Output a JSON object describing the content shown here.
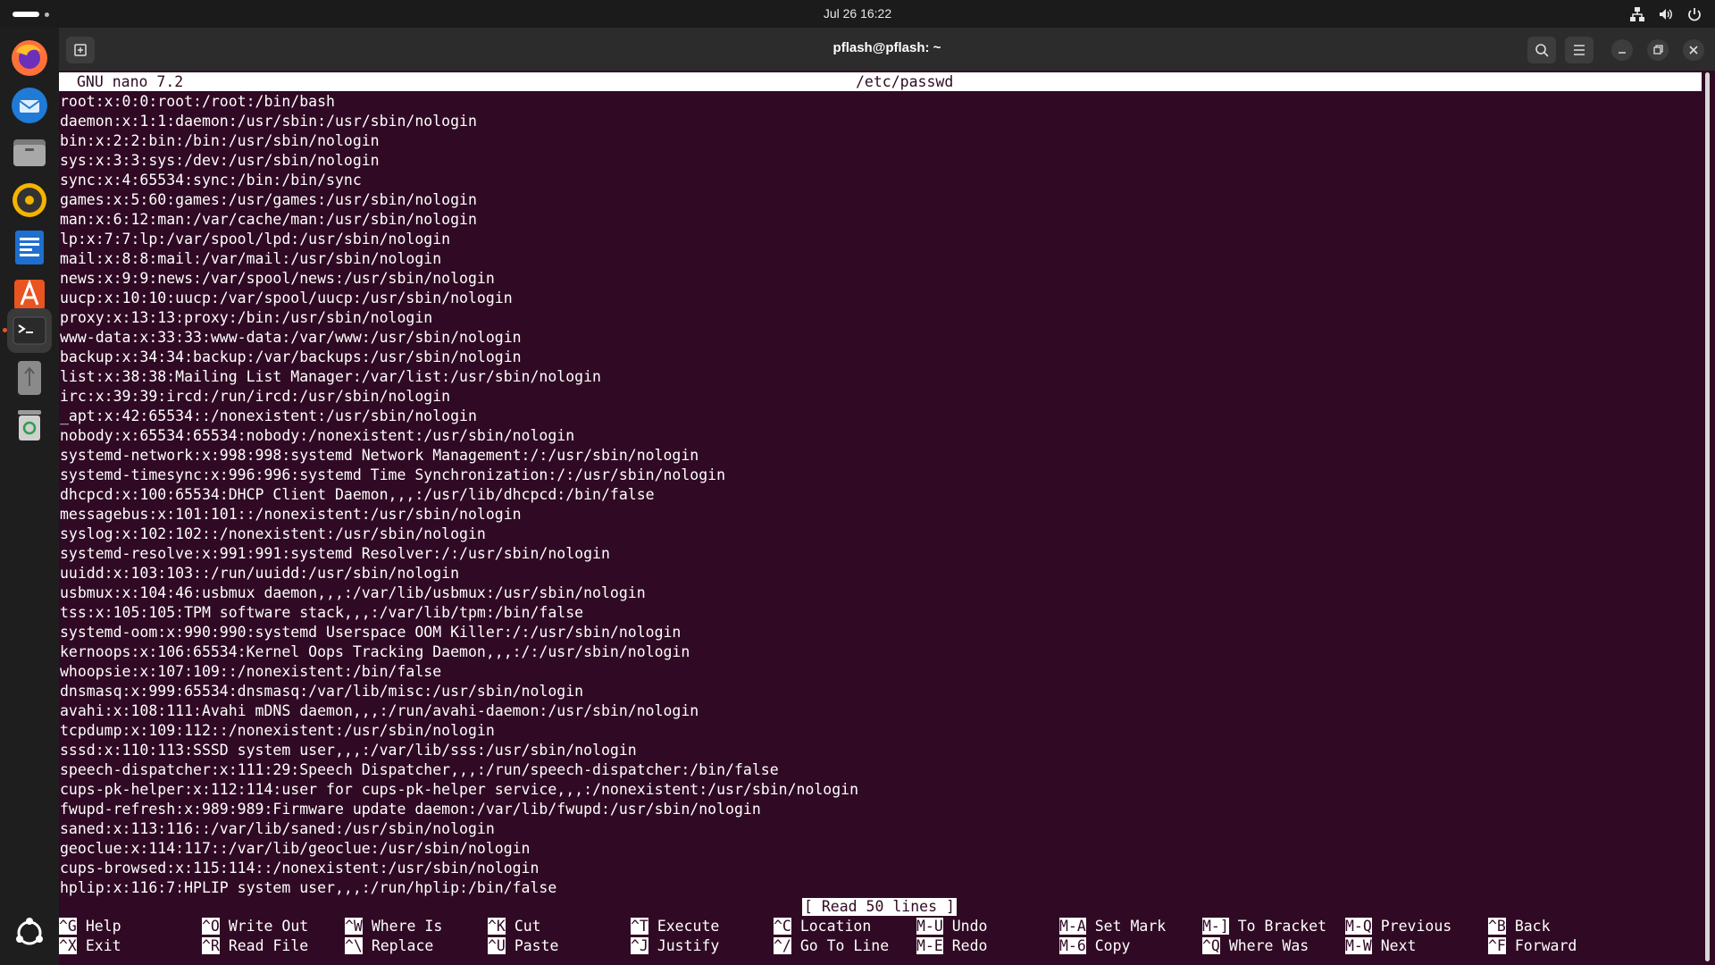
{
  "topbar": {
    "clock": "Jul 26  16:22"
  },
  "window": {
    "title": "pflash@pflash: ~"
  },
  "nano": {
    "version": "GNU nano 7.2",
    "filename": "/etc/passwd",
    "lines": [
      "root:x:0:0:root:/root:/bin/bash",
      "daemon:x:1:1:daemon:/usr/sbin:/usr/sbin/nologin",
      "bin:x:2:2:bin:/bin:/usr/sbin/nologin",
      "sys:x:3:3:sys:/dev:/usr/sbin/nologin",
      "sync:x:4:65534:sync:/bin:/bin/sync",
      "games:x:5:60:games:/usr/games:/usr/sbin/nologin",
      "man:x:6:12:man:/var/cache/man:/usr/sbin/nologin",
      "lp:x:7:7:lp:/var/spool/lpd:/usr/sbin/nologin",
      "mail:x:8:8:mail:/var/mail:/usr/sbin/nologin",
      "news:x:9:9:news:/var/spool/news:/usr/sbin/nologin",
      "uucp:x:10:10:uucp:/var/spool/uucp:/usr/sbin/nologin",
      "proxy:x:13:13:proxy:/bin:/usr/sbin/nologin",
      "www-data:x:33:33:www-data:/var/www:/usr/sbin/nologin",
      "backup:x:34:34:backup:/var/backups:/usr/sbin/nologin",
      "list:x:38:38:Mailing List Manager:/var/list:/usr/sbin/nologin",
      "irc:x:39:39:ircd:/run/ircd:/usr/sbin/nologin",
      "_apt:x:42:65534::/nonexistent:/usr/sbin/nologin",
      "nobody:x:65534:65534:nobody:/nonexistent:/usr/sbin/nologin",
      "systemd-network:x:998:998:systemd Network Management:/:/usr/sbin/nologin",
      "systemd-timesync:x:996:996:systemd Time Synchronization:/:/usr/sbin/nologin",
      "dhcpcd:x:100:65534:DHCP Client Daemon,,,:/usr/lib/dhcpcd:/bin/false",
      "messagebus:x:101:101::/nonexistent:/usr/sbin/nologin",
      "syslog:x:102:102::/nonexistent:/usr/sbin/nologin",
      "systemd-resolve:x:991:991:systemd Resolver:/:/usr/sbin/nologin",
      "uuidd:x:103:103::/run/uuidd:/usr/sbin/nologin",
      "usbmux:x:104:46:usbmux daemon,,,:/var/lib/usbmux:/usr/sbin/nologin",
      "tss:x:105:105:TPM software stack,,,:/var/lib/tpm:/bin/false",
      "systemd-oom:x:990:990:systemd Userspace OOM Killer:/:/usr/sbin/nologin",
      "kernoops:x:106:65534:Kernel Oops Tracking Daemon,,,:/:/usr/sbin/nologin",
      "whoopsie:x:107:109::/nonexistent:/bin/false",
      "dnsmasq:x:999:65534:dnsmasq:/var/lib/misc:/usr/sbin/nologin",
      "avahi:x:108:111:Avahi mDNS daemon,,,:/run/avahi-daemon:/usr/sbin/nologin",
      "tcpdump:x:109:112::/nonexistent:/usr/sbin/nologin",
      "sssd:x:110:113:SSSD system user,,,:/var/lib/sss:/usr/sbin/nologin",
      "speech-dispatcher:x:111:29:Speech Dispatcher,,,:/run/speech-dispatcher:/bin/false",
      "cups-pk-helper:x:112:114:user for cups-pk-helper service,,,:/nonexistent:/usr/sbin/nologin",
      "fwupd-refresh:x:989:989:Firmware update daemon:/var/lib/fwupd:/usr/sbin/nologin",
      "saned:x:113:116::/var/lib/saned:/usr/sbin/nologin",
      "geoclue:x:114:117::/var/lib/geoclue:/usr/sbin/nologin",
      "cups-browsed:x:115:114::/nonexistent:/usr/sbin/nologin",
      "hplip:x:116:7:HPLIP system user,,,:/run/hplip:/bin/false"
    ],
    "status": "[ Read 50 lines ]",
    "shortcuts": [
      [
        {
          "key": "^G",
          "label": "Help"
        },
        {
          "key": "^X",
          "label": "Exit"
        }
      ],
      [
        {
          "key": "^O",
          "label": "Write Out"
        },
        {
          "key": "^R",
          "label": "Read File"
        }
      ],
      [
        {
          "key": "^W",
          "label": "Where Is"
        },
        {
          "key": "^\\",
          "label": "Replace"
        }
      ],
      [
        {
          "key": "^K",
          "label": "Cut"
        },
        {
          "key": "^U",
          "label": "Paste"
        }
      ],
      [
        {
          "key": "^T",
          "label": "Execute"
        },
        {
          "key": "^J",
          "label": "Justify"
        }
      ],
      [
        {
          "key": "^C",
          "label": "Location"
        },
        {
          "key": "^/",
          "label": "Go To Line"
        }
      ],
      [
        {
          "key": "M-U",
          "label": "Undo"
        },
        {
          "key": "M-E",
          "label": "Redo"
        }
      ],
      [
        {
          "key": "M-A",
          "label": "Set Mark"
        },
        {
          "key": "M-6",
          "label": "Copy"
        }
      ],
      [
        {
          "key": "M-]",
          "label": "To Bracket"
        },
        {
          "key": "^Q",
          "label": "Where Was"
        }
      ],
      [
        {
          "key": "M-Q",
          "label": "Previous"
        },
        {
          "key": "M-W",
          "label": "Next"
        }
      ],
      [
        {
          "key": "^B",
          "label": "Back"
        },
        {
          "key": "^F",
          "label": "Forward"
        }
      ]
    ]
  },
  "dock": {
    "apps": [
      "firefox-icon",
      "thunderbird-icon",
      "files-icon",
      "rhythmbox-icon",
      "writer-icon",
      "app-center-icon",
      "terminal-icon",
      "usb-drive-icon",
      "trash-icon"
    ],
    "show_apps": "show-apps-icon"
  }
}
